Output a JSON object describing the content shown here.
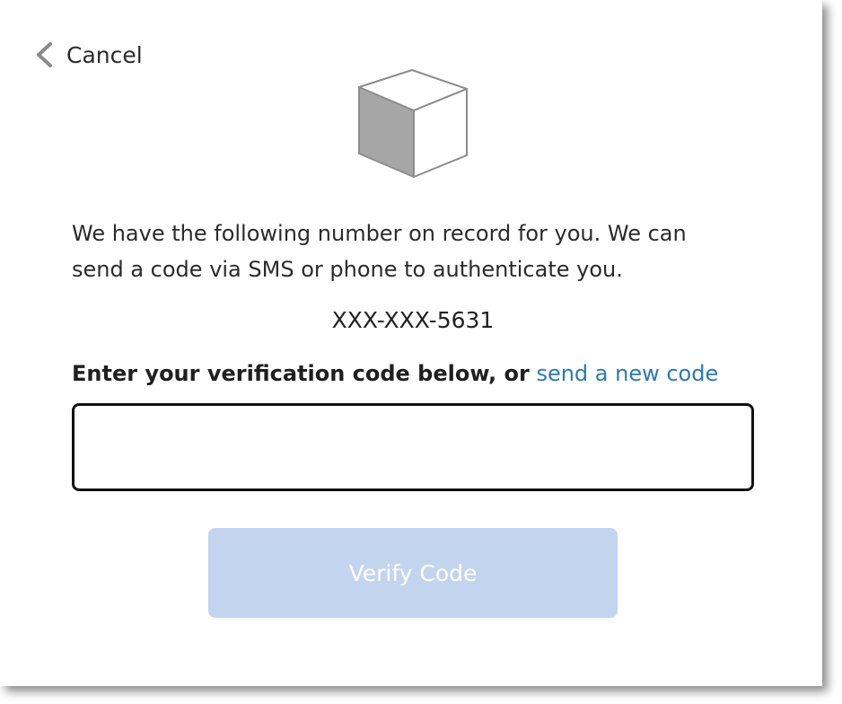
{
  "header": {
    "cancel_label": "Cancel"
  },
  "icons": {
    "back": "chevron-left-icon",
    "illustration": "cube-icon"
  },
  "message": {
    "description": "We have the following number on record for you. We can send a code via SMS or phone to authenticate you.",
    "phone_number": "XXX-XXX-5631"
  },
  "verification": {
    "prompt_bold": "Enter your verification code below, or",
    "resend_link": "send a new code",
    "code_value": "",
    "verify_button": "Verify Code",
    "verify_enabled": false
  },
  "colors": {
    "link": "#2a78b8",
    "button_disabled_bg": "#c3d5ee",
    "cube_dark": "#a6a6a6",
    "cube_outline": "#8c8c8c"
  }
}
